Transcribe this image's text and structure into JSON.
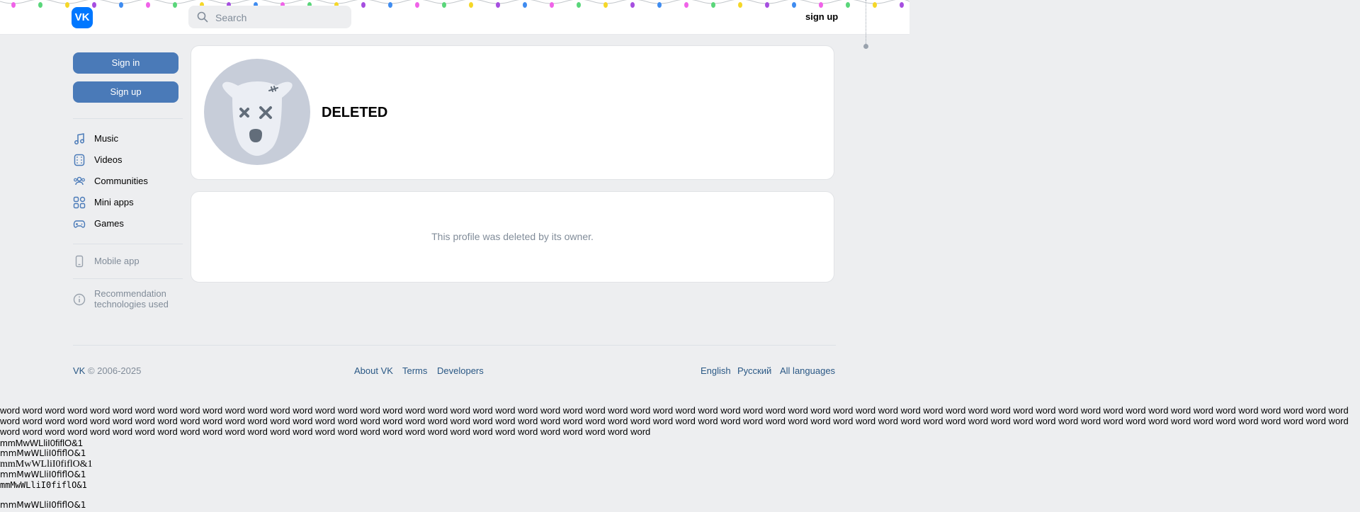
{
  "header": {
    "logo_text": "VK",
    "search_placeholder": "Search",
    "sign_up_link": "sign up"
  },
  "sidebar": {
    "sign_in_button": "Sign in",
    "sign_up_button": "Sign up",
    "nav": [
      {
        "label": "Music",
        "icon": "music-note-icon"
      },
      {
        "label": "Videos",
        "icon": "video-icon"
      },
      {
        "label": "Communities",
        "icon": "communities-icon"
      },
      {
        "label": "Mini apps",
        "icon": "mini-apps-icon"
      },
      {
        "label": "Games",
        "icon": "gamepad-icon"
      }
    ],
    "mobile_app": "Mobile app",
    "recommendation_line1": "Recommendation",
    "recommendation_line2": "technologies used"
  },
  "profile": {
    "name": "DELETED",
    "deleted_message": "This profile was deleted by its owner."
  },
  "footer": {
    "brand": "VK",
    "years": "© 2006-2025",
    "links": [
      "About VK",
      "Terms",
      "Developers"
    ],
    "languages": [
      "English",
      "Русский",
      "All languages"
    ]
  },
  "test_text": {
    "word_block": "word word word word word word word word word word word word word word word word word word word word word word word word word word word word word word word word word word word word word word word word word word word word word word word word word word word word word word word word word word word word word word word word word word word word word word word word word word word word word word word word word word word word word word word word word word word word word word word word word word word word word word word word word word word word word word word word word word word word word word word word word word word word word word word word word word word word word word word word word word word word word word word word word word word word word",
    "font_samples": [
      "mmMwWLliI0fiflO&1",
      "mmMwWLliI0fiflO&1",
      "mmMwWLliI0fiflO&1",
      "mmMwWLliI0fiflO&1",
      "mmMwWLliI0fiflO&1",
      "mmMwWLliI0fiflO&1"
    ]
  },
  "colors": {
    "accent": "#4a7ab8",
    "brand": "#0077ff",
    "link": "#2a5885",
    "muted": "#818c99",
    "background": "#edeef0"
  }
}
